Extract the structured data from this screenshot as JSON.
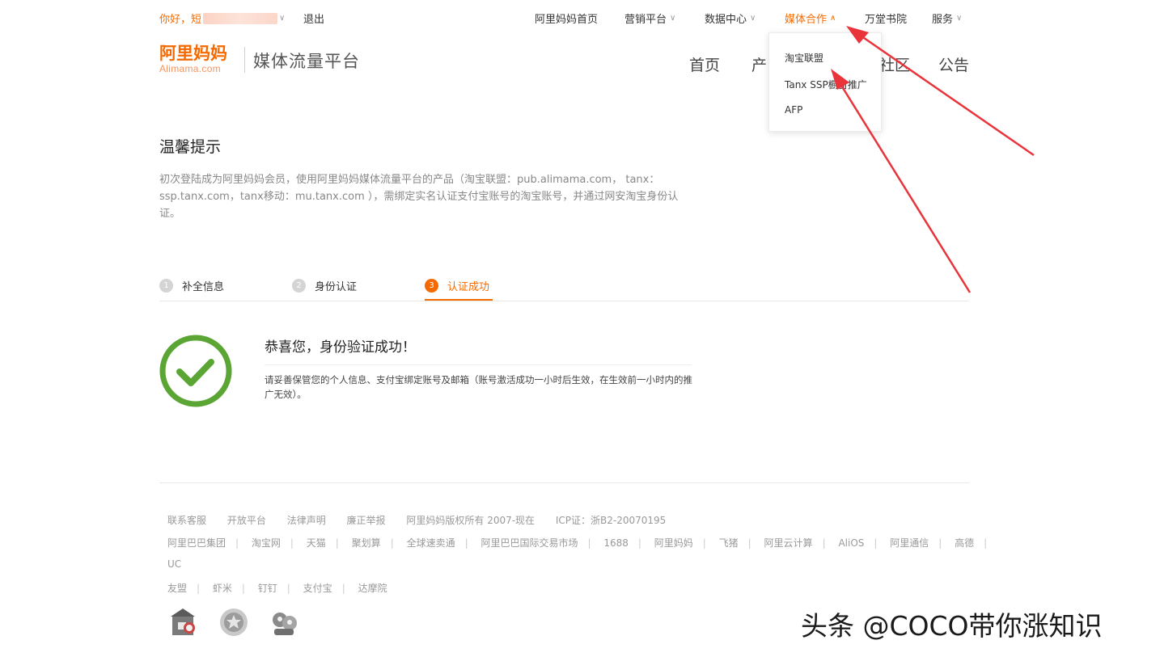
{
  "topbar": {
    "greeting": "你好，短",
    "logout": "退出",
    "nav": [
      {
        "label": "阿里妈妈首页",
        "has_chevron": false
      },
      {
        "label": "营销平台",
        "has_chevron": true
      },
      {
        "label": "数据中心",
        "has_chevron": true
      },
      {
        "label": "媒体合作",
        "has_chevron": true,
        "active": true
      },
      {
        "label": "万堂书院",
        "has_chevron": false
      },
      {
        "label": "服务",
        "has_chevron": true
      }
    ]
  },
  "header": {
    "logo_cn": "阿里妈妈",
    "logo_en": "Alimama.com",
    "platform_title": "媒体流量平台",
    "main_nav": [
      "首页",
      "产",
      "社区",
      "公告"
    ]
  },
  "dropdown": {
    "items": [
      "淘宝联盟",
      "Tanx SSP橱窗推广",
      "AFP"
    ]
  },
  "tip": {
    "title": "温馨提示",
    "body": "初次登陆成为阿里妈妈会员，使用阿里妈妈媒体流量平台的产品（淘宝联盟：pub.alimama.com， tanx：ssp.tanx.com，tanx移动：mu.tanx.com ），需绑定实名认证支付宝账号的淘宝账号，并通过网安淘宝身份认证。"
  },
  "steps": [
    {
      "num": "1",
      "label": "补全信息",
      "active": false
    },
    {
      "num": "2",
      "label": "身份认证",
      "active": false
    },
    {
      "num": "3",
      "label": "认证成功",
      "active": true
    }
  ],
  "success": {
    "title": "恭喜您，身份验证成功！",
    "body": "请妥善保管您的个人信息、支付宝绑定账号及邮箱（账号激活成功一小时后生效，在生效前一小时内的推广无效）。"
  },
  "footer": {
    "row1": [
      "联系客服",
      "开放平台",
      "法律声明",
      "廉正举报",
      "阿里妈妈版权所有 2007-现在",
      "ICP证：浙B2-20070195"
    ],
    "row2": [
      "阿里巴巴集团",
      "淘宝网",
      "天猫",
      "聚划算",
      "全球速卖通",
      "阿里巴巴国际交易市场",
      "1688",
      "阿里妈妈",
      "飞猪",
      "阿里云计算",
      "AliOS",
      "阿里通信",
      "高德"
    ],
    "row3": [
      "UC"
    ],
    "row4": [
      "友盟",
      "虾米",
      "钉钉",
      "支付宝",
      "达摩院"
    ]
  },
  "watermark": "头条 @COCO带你涨知识",
  "colors": {
    "accent": "#f56a00",
    "success_green": "#5aa534",
    "annotation_red": "#e8343a"
  }
}
